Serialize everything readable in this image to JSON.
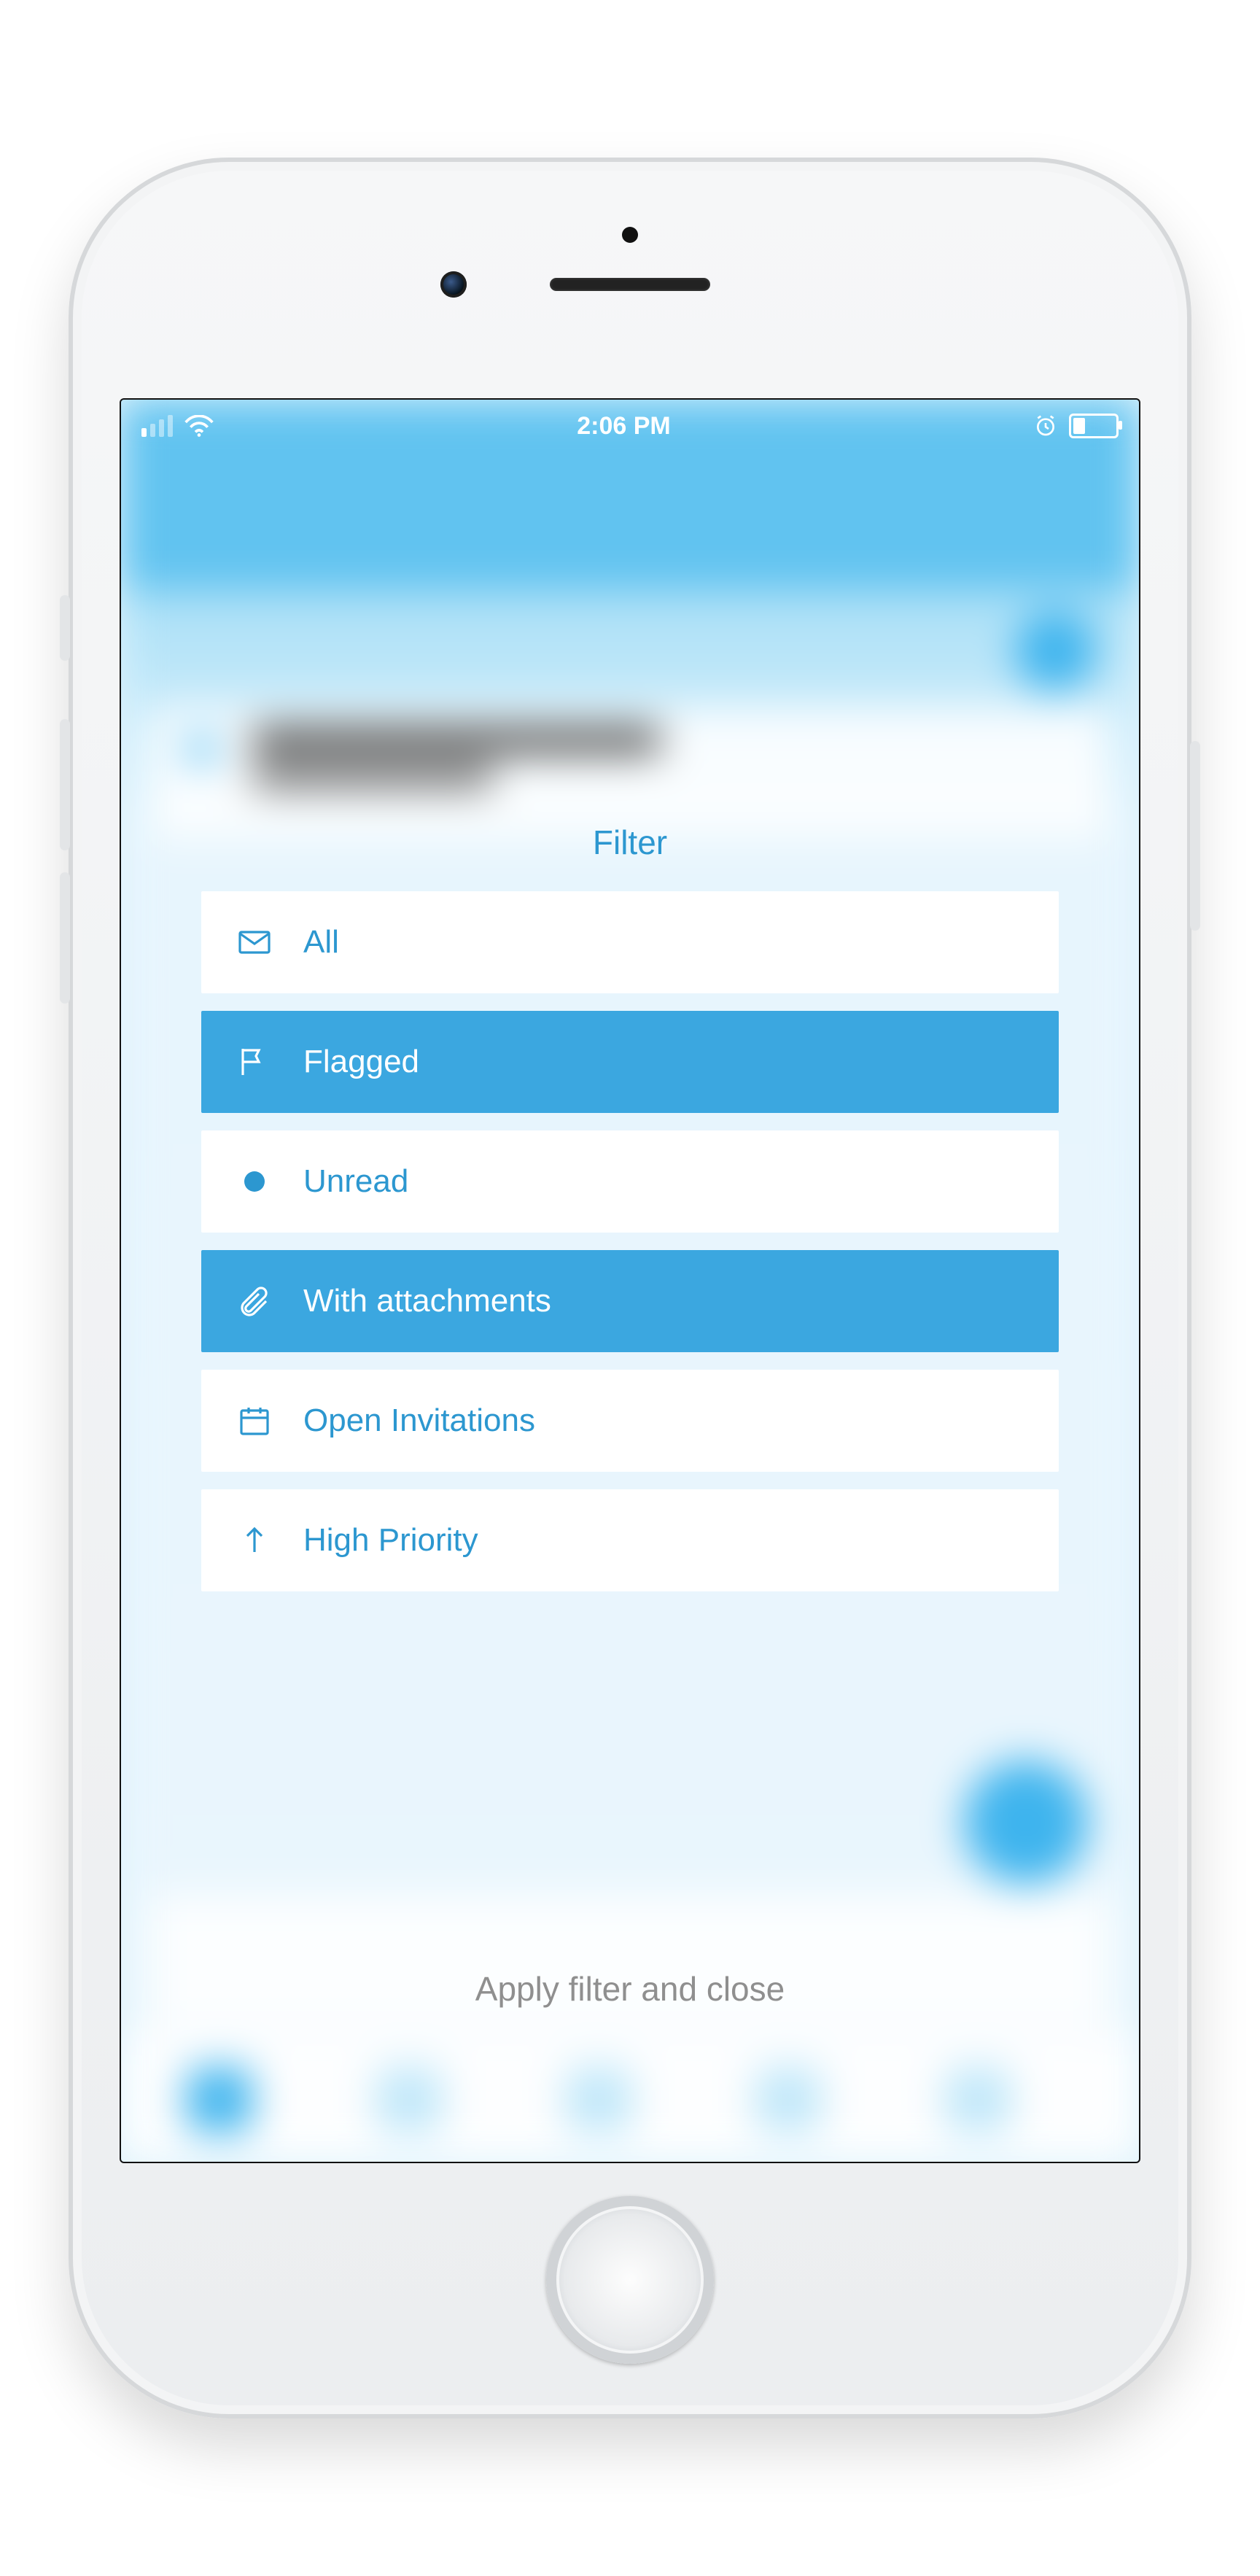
{
  "status": {
    "time": "2:06 PM"
  },
  "sheet": {
    "title": "Filter",
    "items": [
      {
        "label": "All"
      },
      {
        "label": "Flagged"
      },
      {
        "label": "Unread"
      },
      {
        "label": "With attachments"
      },
      {
        "label": "Open Invitations"
      },
      {
        "label": "High Priority"
      }
    ]
  },
  "actions": {
    "apply": "Apply filter and close"
  }
}
